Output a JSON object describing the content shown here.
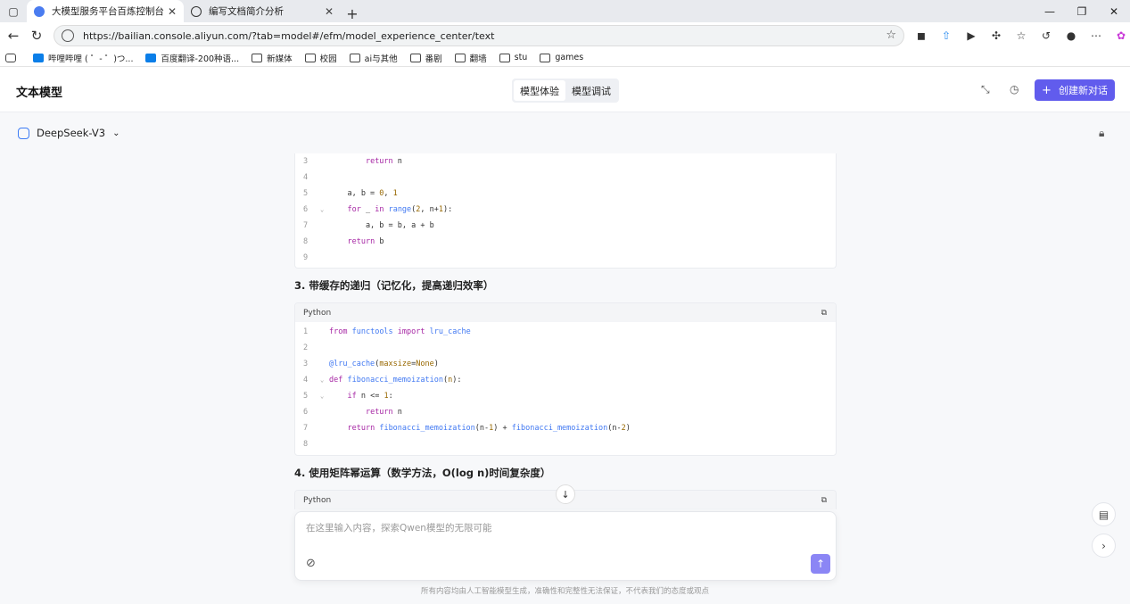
{
  "browser": {
    "tabs": [
      {
        "title": "大模型服务平台百炼控制台"
      },
      {
        "title": "编写文档简介分析"
      }
    ],
    "url": "https://bailian.console.aliyun.com/?tab=model#/efm/model_experience_center/text",
    "bookmarks": [
      "哔哩哔哩 ( ゜- ゜)つ...",
      "百度翻译-200种语...",
      "新媒体",
      "校园",
      "ai与其他",
      "番剧",
      "翻墙",
      "stu",
      "games"
    ]
  },
  "header": {
    "title": "文本模型",
    "segments": [
      "模型体验",
      "模型调试"
    ],
    "create_label": "创建新对话"
  },
  "model": {
    "name": "DeepSeek-V3"
  },
  "code_block_top": {
    "lines": [
      {
        "n": "3",
        "text": "        return n"
      },
      {
        "n": "4",
        "text": ""
      },
      {
        "n": "5",
        "text": "    a, b = 0, 1"
      },
      {
        "n": "6",
        "text": "    for _ in range(2, n+1):"
      },
      {
        "n": "7",
        "text": "        a, b = b, a + b"
      },
      {
        "n": "8",
        "text": "    return b"
      },
      {
        "n": "9",
        "text": ""
      }
    ]
  },
  "section3": {
    "heading": "3. 带缓存的递归（记忆化，提高递归效率）"
  },
  "code_block_mid": {
    "lang": "Python",
    "lines": [
      {
        "n": "1",
        "text": "from functools import lru_cache"
      },
      {
        "n": "2",
        "text": ""
      },
      {
        "n": "3",
        "text": "@lru_cache(maxsize=None)"
      },
      {
        "n": "4",
        "text": "def fibonacci_memoization(n):"
      },
      {
        "n": "5",
        "text": "    if n <= 1:"
      },
      {
        "n": "6",
        "text": "        return n"
      },
      {
        "n": "7",
        "text": "    return fibonacci_memoization(n-1) + fibonacci_memoization(n-2)"
      },
      {
        "n": "8",
        "text": ""
      }
    ]
  },
  "section4": {
    "heading": "4. 使用矩阵幂运算（数学方法，O(log n)时间复杂度）"
  },
  "code_block_bottom": {
    "lang": "Python"
  },
  "input": {
    "placeholder": "在这里输入内容，探索Qwen模型的无限可能"
  },
  "footer": {
    "text": "所有内容均由人工智能模型生成，准确性和完整性无法保证，不代表我们的态度或观点"
  }
}
